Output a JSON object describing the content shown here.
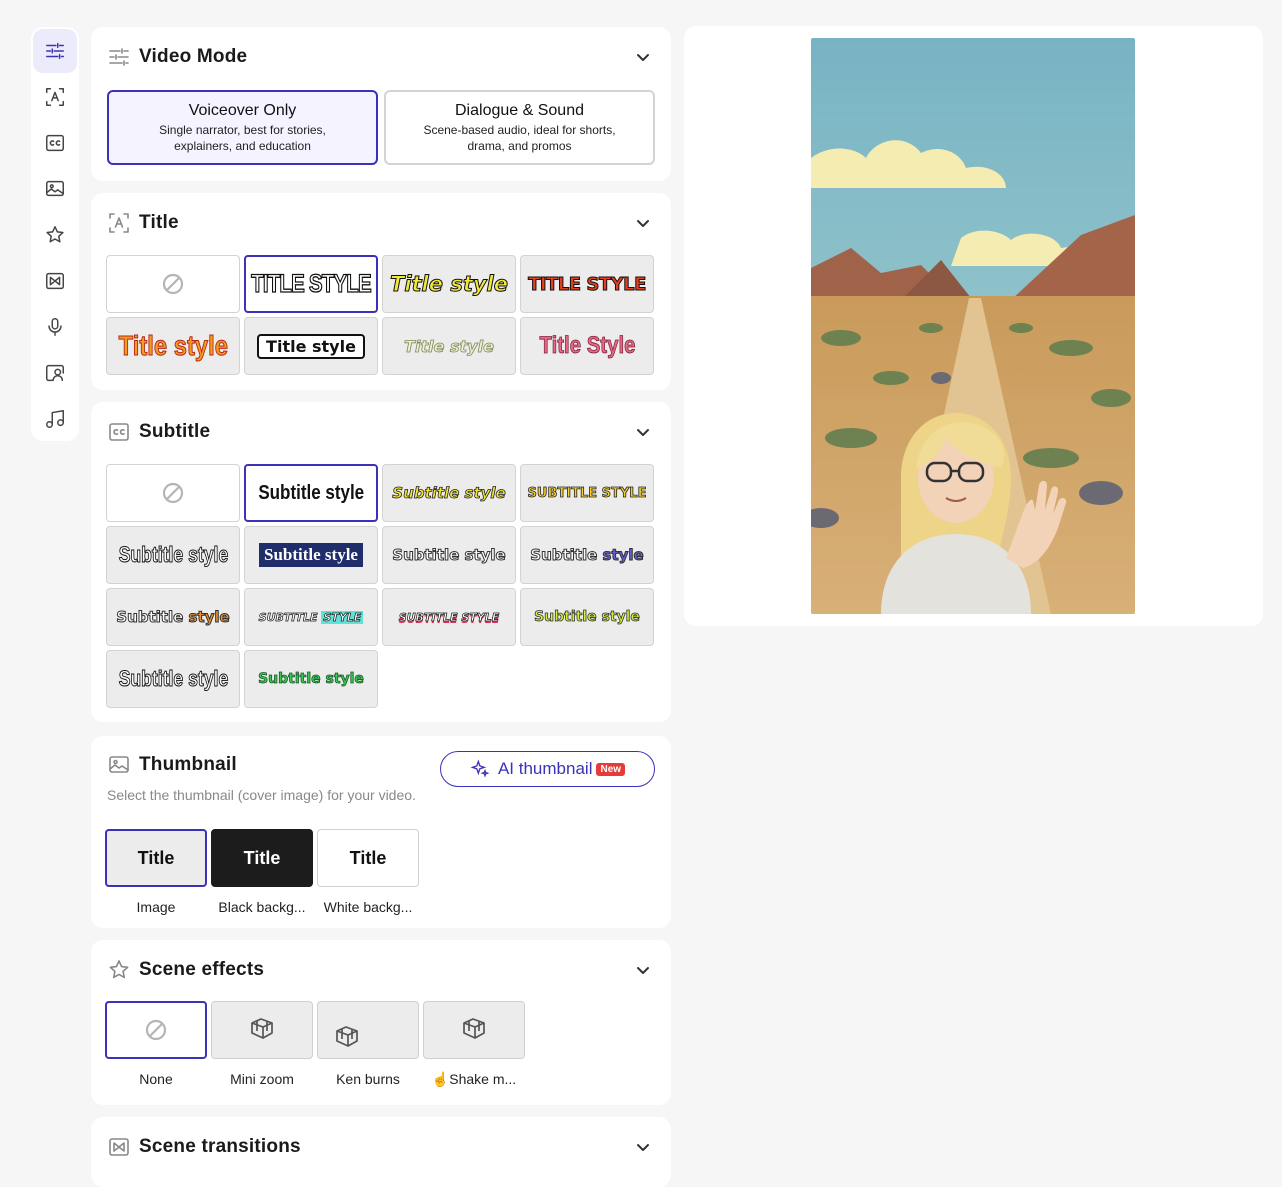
{
  "sidebar": {
    "items": [
      {
        "icon": "sliders-icon",
        "active": true
      },
      {
        "icon": "title-icon",
        "active": false
      },
      {
        "icon": "cc-icon",
        "active": false
      },
      {
        "icon": "image-icon",
        "active": false
      },
      {
        "icon": "star-icon",
        "active": false
      },
      {
        "icon": "transition-icon",
        "active": false
      },
      {
        "icon": "microphone-icon",
        "active": false
      },
      {
        "icon": "avatar-icon",
        "active": false
      },
      {
        "icon": "music-icon",
        "active": false
      }
    ]
  },
  "video_mode": {
    "title": "Video Mode",
    "options": [
      {
        "title": "Voiceover Only",
        "desc": "Single narrator, best for stories, explainers, and education"
      },
      {
        "title": "Dialogue & Sound",
        "desc": "Scene-based audio, ideal for shorts, drama, and promos"
      }
    ]
  },
  "title_section": {
    "title": "Title",
    "styles": [
      "TITLE STYLE",
      "Title style",
      "TITLE STYLE",
      "Title style",
      "Title style",
      "Title style",
      "Title Style"
    ]
  },
  "subtitle_section": {
    "title": "Subtitle",
    "styles": [
      "Subtitle style",
      "Subtitle style",
      "SUBTITLE STYLE",
      "Subtitle style",
      "Subtitle style",
      "Subtitle style",
      "Subtitle",
      "style",
      "Subtitle",
      "style",
      "SUBTITLE",
      "STYLE",
      "SUBTITLE STYLE",
      "Subtitle style",
      "Subtitle style",
      "Subtitle style"
    ]
  },
  "thumbnail": {
    "title": "Thumbnail",
    "subtitle": "Select the thumbnail (cover image) for your video.",
    "ai_button": "AI thumbnail",
    "ai_badge": "New",
    "options": [
      {
        "box_text": "Title",
        "label": "Image"
      },
      {
        "box_text": "Title",
        "label": "Black backg..."
      },
      {
        "box_text": "Title",
        "label": "White backg..."
      }
    ]
  },
  "scene_effects": {
    "title": "Scene effects",
    "options": [
      "None",
      "Mini zoom",
      "Ken burns",
      "Shake m..."
    ]
  },
  "scene_transitions": {
    "title": "Scene transitions"
  },
  "colors": {
    "accent": "#3b32b8",
    "selected_bg": "#f4f3ff",
    "badge": "#e53b3b"
  }
}
